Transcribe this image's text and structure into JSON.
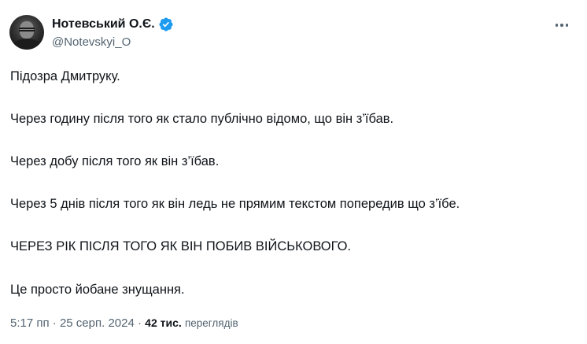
{
  "author": {
    "display_name": "Нотевський О.Є.",
    "handle": "@Notevskyi_O",
    "verified_icon": "verified-badge-icon",
    "verified_color": "#1d9bf0"
  },
  "tweet": {
    "paragraphs": [
      "Підозра Дмитруку.",
      "Через годину після того як стало публічно відомо, що він з’їбав.",
      "Через добу після того як він з’їбав.",
      "Через 5 днів після того як він ледь не прямим текстом попередив що з’їбе.",
      "ЧЕРЕЗ РІК ПІСЛЯ ТОГО ЯК ВІН ПОБИВ ВІЙСЬКОВОГО.",
      "Це просто йобане знущання."
    ]
  },
  "meta": {
    "time": "5:17 пп",
    "separator": "·",
    "date": "25 серп. 2024",
    "views_count": "42 тис.",
    "views_label": "переглядів"
  },
  "menu": {
    "more_icon": "more-horizontal-icon"
  }
}
